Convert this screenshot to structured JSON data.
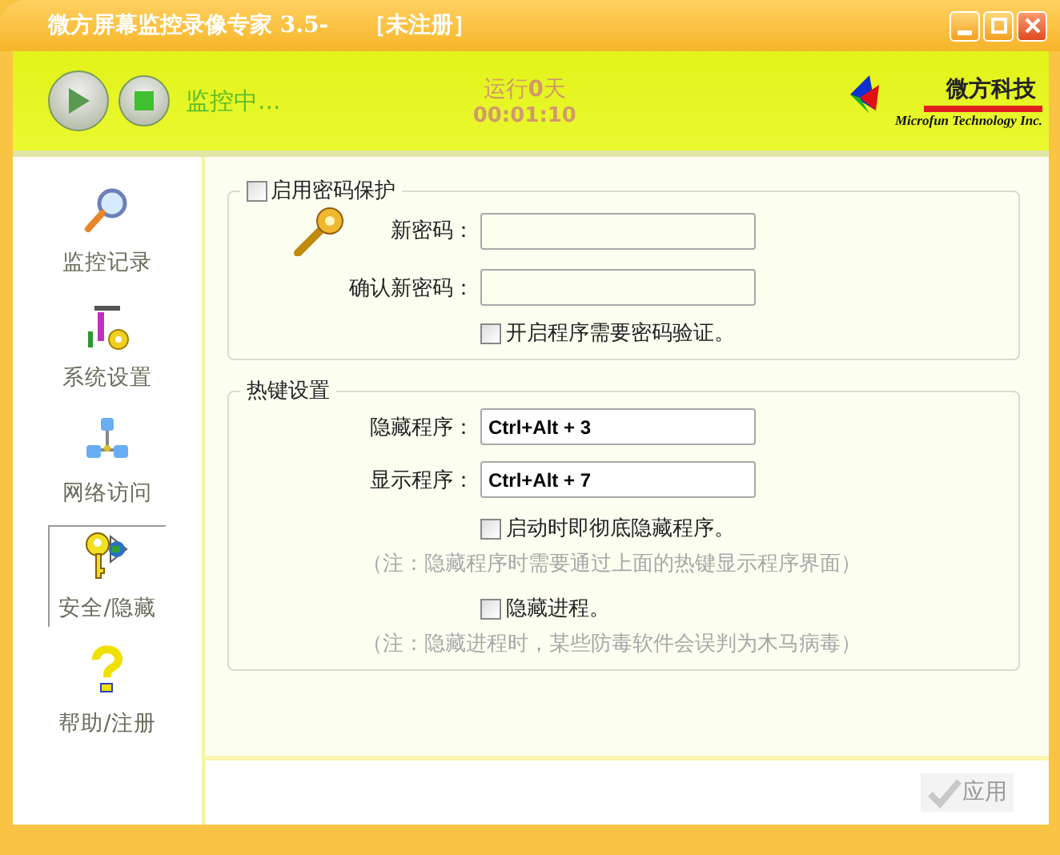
{
  "window": {
    "title": "微方屏幕监控录像专家 3.5-",
    "registration": "［未注册］"
  },
  "toolbar": {
    "status": "监控中...",
    "runtime": "运行**0**天",
    "timer": "00:01:10",
    "logo_name": "微方科技",
    "logo_company": "Microfun Technology Inc."
  },
  "sidebar": {
    "items": [
      {
        "label": "监控记录",
        "kind": "search",
        "selected": false
      },
      {
        "label": "系统设置",
        "kind": "tools",
        "selected": false
      },
      {
        "label": "网络访问",
        "kind": "network",
        "selected": false
      },
      {
        "label": "安全/隐藏",
        "kind": "key",
        "selected": true
      },
      {
        "label": "帮助/注册",
        "kind": "help",
        "selected": false
      }
    ]
  },
  "password_group": {
    "label": "启用密码保护",
    "checked": false,
    "fields": [
      {
        "label": "新密码："
      },
      {
        "label": "确认新密码："
      }
    ],
    "verify": {
      "label": "开启程序需要密码验证。",
      "checked": false
    }
  },
  "hotkey_group": {
    "title": "热键设置",
    "fields": [
      {
        "label": "隐藏程序：",
        "value": "Ctrl+Alt + 3"
      },
      {
        "label": "显示程序：",
        "value": "Ctrl+Alt + 7"
      }
    ],
    "options": [
      {
        "label": "启动时即彻底隐藏程序。",
        "checked": false,
        "note": "（注：隐藏程序时需要通过上面的热键显示程序界面）"
      },
      {
        "label": "隐藏进程。",
        "checked": false,
        "note": "（注：隐藏进程时，某些防毒软件会误判为木马病毒）"
      }
    ]
  },
  "apply_button": {
    "label": "应用",
    "disabled": true
  }
}
